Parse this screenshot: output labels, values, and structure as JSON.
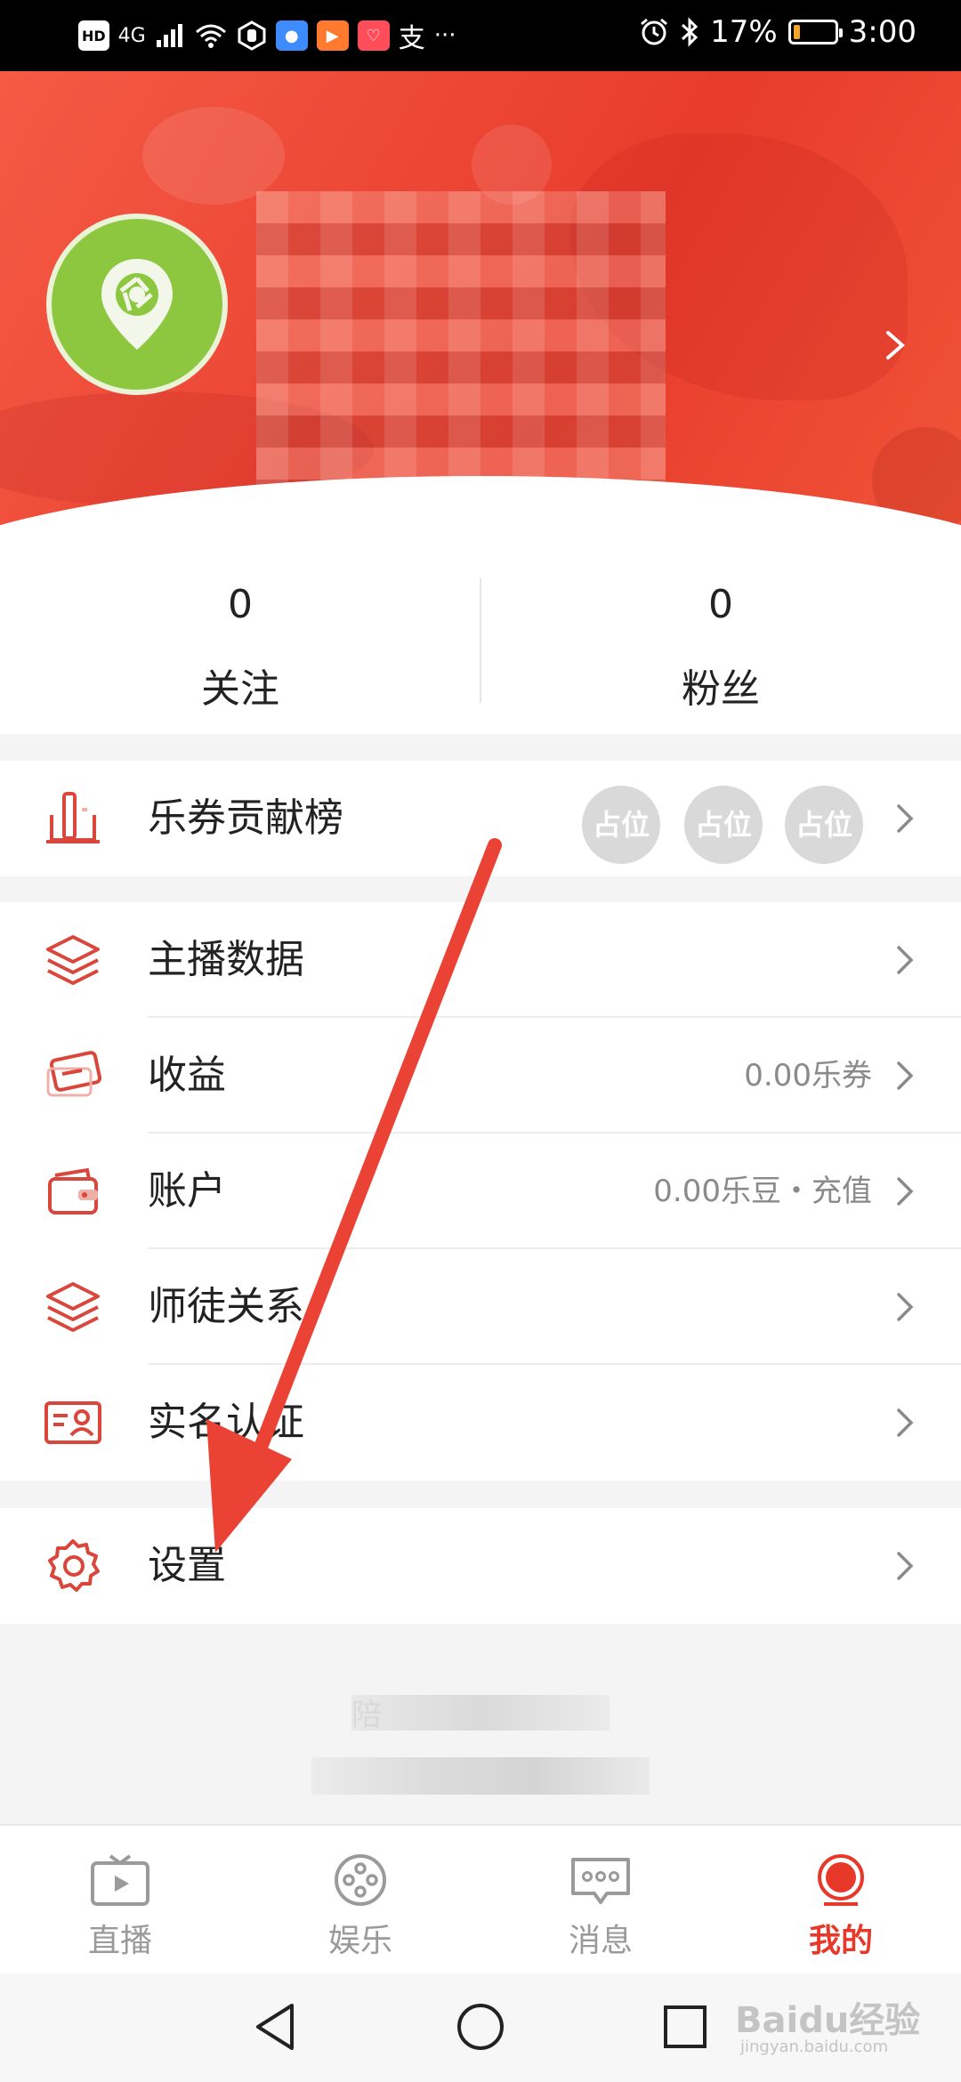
{
  "status_bar": {
    "network_hd": "HD",
    "network_type": "4G",
    "battery_percent": "17%",
    "battery_level": 0.17,
    "time": "3:00",
    "more": "···"
  },
  "header": {
    "avatar_icon": "camera-pin-icon",
    "chevron_icon": "chevron-right-icon"
  },
  "stats": {
    "following": {
      "count": "0",
      "label": "关注"
    },
    "fans": {
      "count": "0",
      "label": "粉丝"
    }
  },
  "contribution": {
    "label": "乐券贡献榜",
    "badges": [
      "占位",
      "占位",
      "占位"
    ]
  },
  "menu": {
    "items": [
      {
        "label": "主播数据",
        "value": "",
        "icon": "layers-icon"
      },
      {
        "label": "收益",
        "value": "0.00乐券",
        "icon": "ticket-icon"
      },
      {
        "label": "账户",
        "value": "0.00乐豆・充值",
        "icon": "wallet-icon"
      },
      {
        "label": "师徒关系",
        "value": "",
        "icon": "layers-icon"
      },
      {
        "label": "实名认证",
        "value": "",
        "icon": "id-card-icon"
      }
    ]
  },
  "settings": {
    "label": "设置",
    "icon": "gear-icon"
  },
  "footer_text": {
    "line1": "陪"
  },
  "tabbar": {
    "tabs": [
      {
        "label": "直播",
        "icon": "tv-icon",
        "active": false
      },
      {
        "label": "娱乐",
        "icon": "film-reel-icon",
        "active": false
      },
      {
        "label": "消息",
        "icon": "message-icon",
        "active": false
      },
      {
        "label": "我的",
        "icon": "record-dot-icon",
        "active": true
      }
    ]
  },
  "watermark": {
    "text": "Baidu经验",
    "url_text": "jingyan.baidu.com"
  },
  "colors": {
    "accent": "#e8382a",
    "icon_red": "#d9463b",
    "header_gradient": "#f45a45"
  }
}
